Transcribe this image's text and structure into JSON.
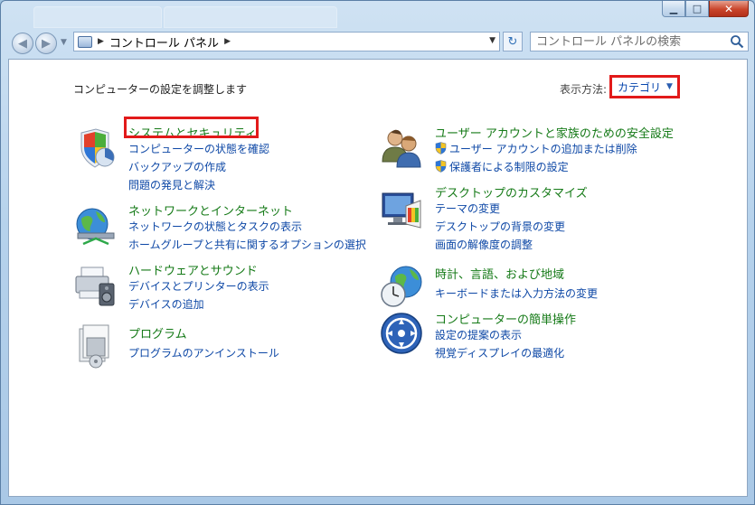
{
  "window": {
    "breadcrumb": "コントロール パネル",
    "search_placeholder": "コントロール パネルの検索"
  },
  "header": {
    "subtitle": "コンピューターの設定を調整します",
    "view_label": "表示方法:",
    "view_value": "カテゴリ"
  },
  "categories_left": [
    {
      "title": "システムとセキュリティ",
      "icon": "system-security-icon",
      "links": [
        "コンピューターの状態を確認",
        "バックアップの作成",
        "問題の発見と解決"
      ]
    },
    {
      "title": "ネットワークとインターネット",
      "icon": "network-internet-icon",
      "links": [
        "ネットワークの状態とタスクの表示",
        "ホームグループと共有に関するオプションの選択"
      ]
    },
    {
      "title": "ハードウェアとサウンド",
      "icon": "hardware-sound-icon",
      "links": [
        "デバイスとプリンターの表示",
        "デバイスの追加"
      ]
    },
    {
      "title": "プログラム",
      "icon": "programs-icon",
      "links": [
        "プログラムのアンインストール"
      ]
    }
  ],
  "categories_right": [
    {
      "title": "ユーザー アカウントと家族のための安全設定",
      "icon": "user-accounts-icon",
      "links": [
        "ユーザー アカウントの追加または削除",
        "保護者による制限の設定"
      ]
    },
    {
      "title": "デスクトップのカスタマイズ",
      "icon": "appearance-icon",
      "links": [
        "テーマの変更",
        "デスクトップの背景の変更",
        "画面の解像度の調整"
      ]
    },
    {
      "title": "時計、言語、および地域",
      "icon": "clock-region-icon",
      "links": [
        "キーボードまたは入力方法の変更"
      ]
    },
    {
      "title": "コンピューターの簡単操作",
      "icon": "ease-of-access-icon",
      "links": [
        "設定の提案の表示",
        "視覚ディスプレイの最適化"
      ]
    }
  ],
  "colors": {
    "title_green": "#157a17",
    "link_blue": "#0e48a6",
    "highlight_red": "#e21a1a"
  }
}
